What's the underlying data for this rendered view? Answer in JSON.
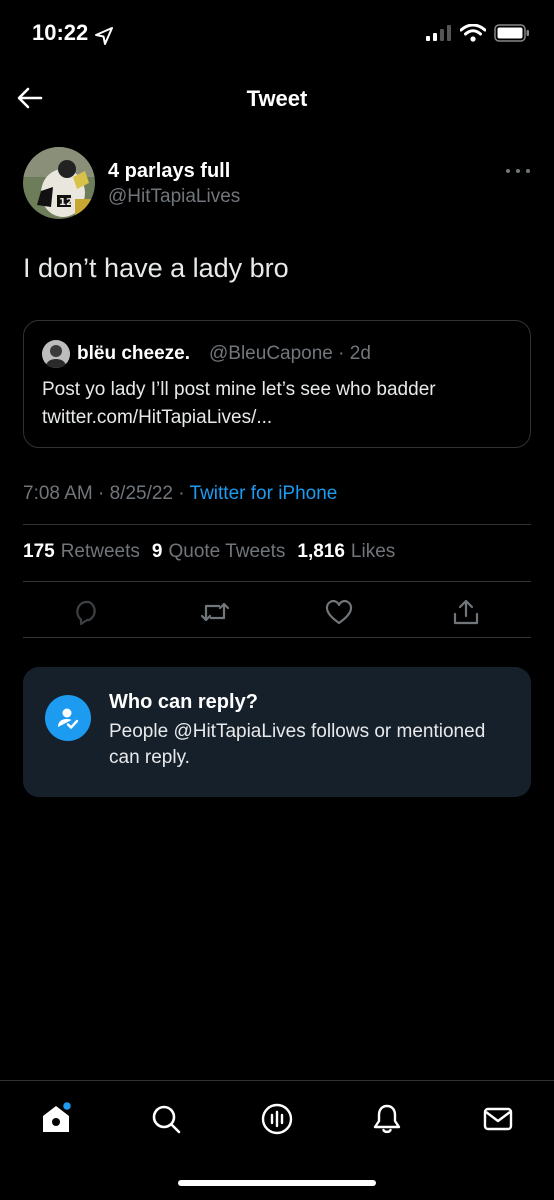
{
  "status_bar": {
    "time": "10:22"
  },
  "header": {
    "title": "Tweet"
  },
  "tweet": {
    "author_name": "4 parlays full",
    "author_handle": "@HitTapiaLives",
    "text": "I don’t have a lady bro",
    "timestamp": "7:08 AM · 8/25/22 · ",
    "source": "Twitter for iPhone"
  },
  "quoted_tweet": {
    "author_name": "blëu cheeze.",
    "author_handle": "@BleuCapone · 2d",
    "text": "Post yo lady I’ll post mine let’s see who badder twitter.com/HitTapiaLives/..."
  },
  "stats": {
    "retweets_count": "175",
    "retweets_label": "Retweets",
    "quote_count": "9",
    "quote_label": "Quote Tweets",
    "likes_count": "1,816",
    "likes_label": "Likes"
  },
  "who_can_reply": {
    "title": "Who can reply?",
    "description": "People @HitTapiaLives follows or mentioned can reply."
  },
  "colors": {
    "accent": "#1d9bf0",
    "background": "#000000",
    "card": "#16202b",
    "muted_text": "#71767b",
    "divider": "#2f3336"
  }
}
